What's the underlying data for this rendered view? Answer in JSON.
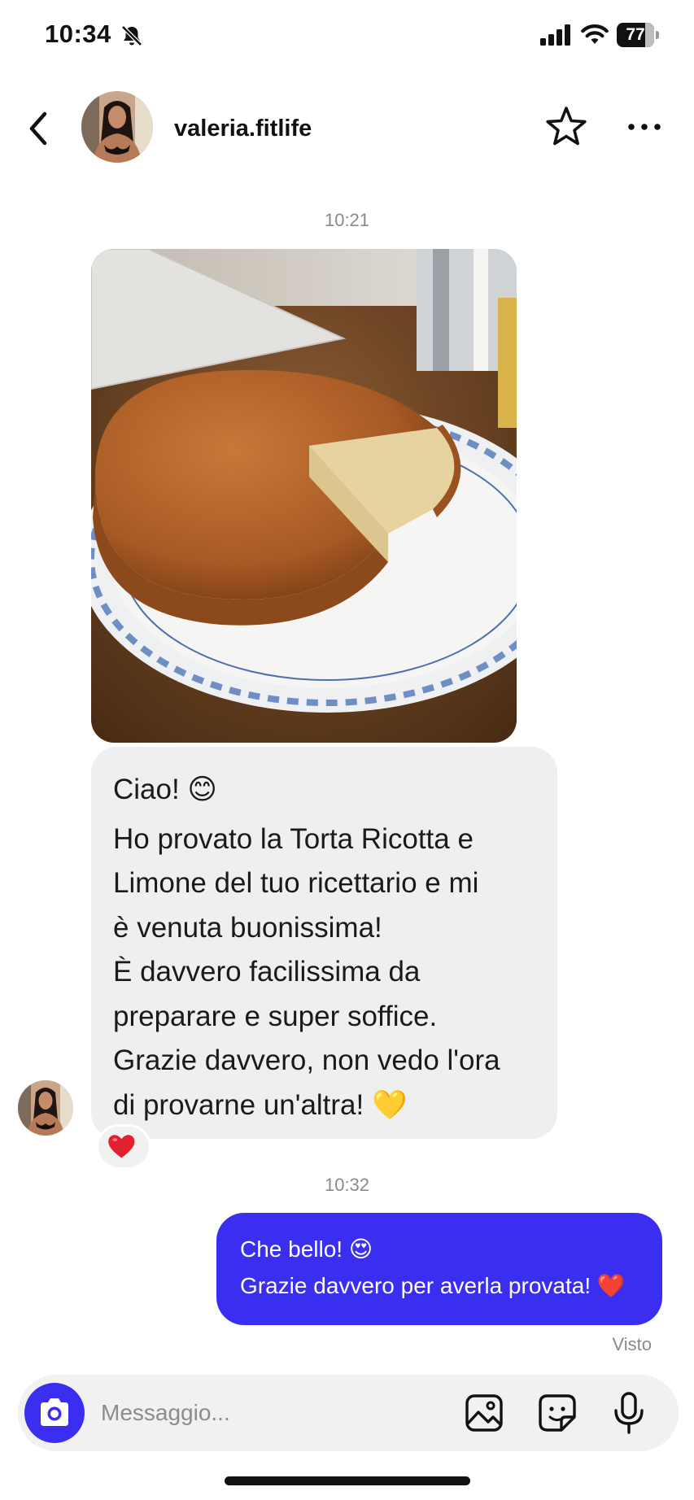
{
  "status_bar": {
    "time": "10:34",
    "battery": "77",
    "battery_level": 0.77,
    "icons": [
      "bell-slash-icon",
      "cellular-signal-icon",
      "wifi-icon",
      "battery-icon"
    ]
  },
  "header": {
    "username": "valeria.fitlife",
    "icons": [
      "chevron-left-icon",
      "star-icon",
      "more-horizontal-icon"
    ]
  },
  "conversation": {
    "timestamp_1": "10:21",
    "incoming_lines": [
      "Ciao! 😊",
      "Ho provato la Torta Ricotta e",
      "Limone del tuo ricettario e mi",
      "è venuta buonissima!",
      "È davvero facilissima da",
      "preparare e super soffice.",
      "Grazie davvero, non vedo l'ora",
      "di provarne un'altra! 💛"
    ],
    "reaction": "❤️",
    "timestamp_2": "10:32",
    "outgoing_lines": [
      "Che bello! 😍",
      "Grazie davvero per averla provata! ❤️"
    ],
    "seen": "Visto"
  },
  "composer": {
    "placeholder": "Messaggio...",
    "icons": [
      "camera-icon",
      "gallery-icon",
      "sticker-icon",
      "microphone-icon"
    ]
  },
  "colors": {
    "accent": "#3a2ff1",
    "incoming_bubble": "#efefef",
    "muted_text": "#8a8a8a"
  }
}
